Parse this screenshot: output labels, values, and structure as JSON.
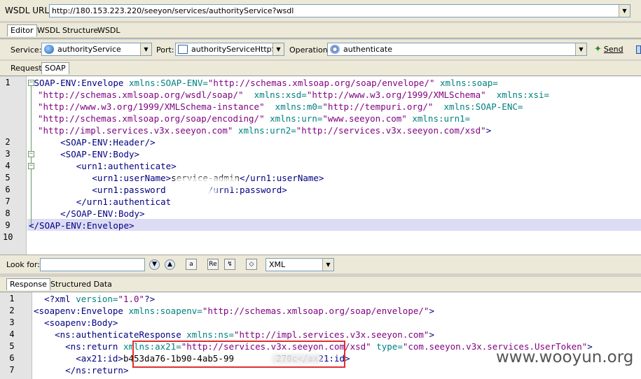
{
  "wsdl": {
    "label": "WSDL URL:",
    "url": "http://180.153.223.220/seeyon/services/authorityService?wsdl"
  },
  "top_tabs": [
    "Editor",
    "WSDL Structure",
    "WSDL"
  ],
  "service_bar": {
    "service_label": "Service:",
    "service_value": "authorityService",
    "port_label": "Port:",
    "port_value": "authorityServiceHttpSoa",
    "operation_label": "Operation:",
    "operation_value": "authenticate",
    "send_label": "Send"
  },
  "request_tabs": [
    "Request",
    "SOAP"
  ],
  "request_lines": [
    {
      "n": "1",
      "html": "<span class='t'>&lt;SOAP-ENV:Envelope</span> <span class='a'>xmlns:SOAP-ENV=</span><span class='v'>\"http://schemas.xmlsoap.org/soap/envelope/\"</span> <span class='a'>xmlns:soap=</span>"
    },
    {
      "n": "",
      "html": "<span class='v'>\"http://schemas.xmlsoap.org/wsdl/soap/\"</span>  <span class='a'>xmlns:xsd=</span><span class='v'>\"http://www.w3.org/1999/XMLSchema\"</span>  <span class='a'>xmlns:xsi=</span>"
    },
    {
      "n": "",
      "html": "<span class='v'>\"http://www.w3.org/1999/XMLSchema-instance\"</span>  <span class='a'>xmlns:m0=</span><span class='v'>\"http://tempuri.org/\"</span>  <span class='a'>xmlns:SOAP-ENC=</span>"
    },
    {
      "n": "",
      "html": "<span class='v'>\"http://schemas.xmlsoap.org/soap/encoding/\"</span> <span class='a'>xmlns:urn=</span><span class='v'>\"www.seeyon.com\"</span> <span class='a'>xmlns:urn1=</span>"
    },
    {
      "n": "",
      "html": "<span class='v'>\"http://impl.services.v3x.seeyon.com\"</span> <span class='a'>xmlns:urn2=</span><span class='v'>\"http://services.v3x.seeyon.com/xsd\"</span><span class='t'>&gt;</span>"
    },
    {
      "n": "2",
      "html": "      <span class='t'>&lt;SOAP-ENV:Header/&gt;</span>"
    },
    {
      "n": "3",
      "html": "      <span class='t'>&lt;SOAP-ENV:Body&gt;</span>"
    },
    {
      "n": "4",
      "html": "         <span class='t'>&lt;urn1:authenticate&gt;</span>"
    },
    {
      "n": "5",
      "html": "            <span class='t'>&lt;urn1:userName&gt;</span>service-admin<span class='t'>&lt;/urn1:userName&gt;</span>"
    },
    {
      "n": "6",
      "html": "            <span class='t'>&lt;urn1:password</span>        <span class='t'>/urn1:password&gt;</span>"
    },
    {
      "n": "7",
      "html": "         <span class='t'>&lt;/urn1:authenticat</span>"
    },
    {
      "n": "8",
      "html": "      <span class='t'>&lt;/SOAP-ENV:Body&gt;</span>"
    },
    {
      "n": "9",
      "html": "<span class='t'>&lt;/SOAP-ENV:Envelope&gt;</span>"
    },
    {
      "n": "10",
      "html": ""
    }
  ],
  "look_for": {
    "label": "Look for:",
    "format_value": "XML"
  },
  "response_tabs": [
    "Response",
    "Structured Data"
  ],
  "response_lines": [
    {
      "n": "1",
      "html": "  <span class='t'>&lt;?xml</span> <span class='a'>version=</span><span class='v'>\"1.0\"</span><span class='t'>?&gt;</span>"
    },
    {
      "n": "2",
      "html": "<span class='t'>&lt;soapenv:Envelope</span> <span class='a'>xmlns:soapenv=</span><span class='v'>\"http://schemas.xmlsoap.org/soap/envelope/\"</span><span class='t'>&gt;</span>"
    },
    {
      "n": "3",
      "html": "  <span class='t'>&lt;soapenv:Body&gt;</span>"
    },
    {
      "n": "4",
      "html": "    <span class='t'>&lt;ns:authenticateResponse</span> <span class='a'>xmlns:ns=</span><span class='v'>\"http://impl.services.v3x.seeyon.com\"</span><span class='t'>&gt;</span>"
    },
    {
      "n": "5",
      "html": "      <span class='t'>&lt;ns:return</span> <span class='a'>xmlns:ax21=</span><span class='v'>\"http://services.v3x.seeyon.com/xsd\"</span> <span class='a'>type=</span><span class='v'>\"com.seeyon.v3x.services.UserToken\"</span><span class='t'>&gt;</span>"
    },
    {
      "n": "6",
      "html": "        <span class='t'>&lt;ax21:id&gt;</span>b453da76-1b90-4ab5-99        270c<span class='t'>&lt;/ax21:id&gt;</span>"
    },
    {
      "n": "7",
      "html": "      <span class='t'>&lt;/ns:return&gt;</span>"
    }
  ],
  "watermark": "www.wooyun.org"
}
